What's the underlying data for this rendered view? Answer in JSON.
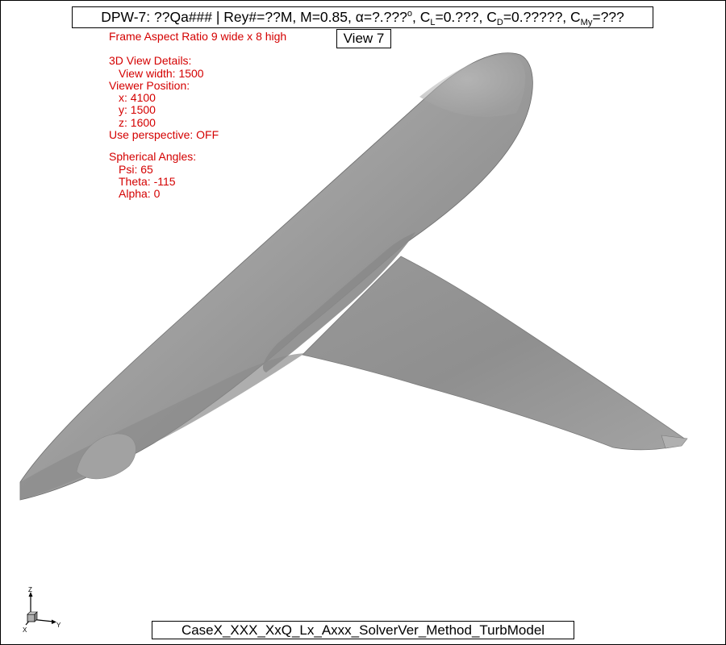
{
  "title": {
    "prefix": "DPW-7: ??Qa### | Rey#=??M, M=0.85, ",
    "alpha_symbol": "α",
    "alpha_value": "=?.???",
    "degree": "o",
    "cl_label": "C",
    "cl_sub": "L",
    "cl_value": "=0.???, ",
    "cd_label": "C",
    "cd_sub": "D",
    "cd_value": "=0.?????, ",
    "cmy_label": "C",
    "cmy_sub": "My",
    "cmy_value": "=???"
  },
  "view_label": "View 7",
  "notes": {
    "aspect": "Frame Aspect Ratio 9 wide x 8 high",
    "details_header": "3D View Details:",
    "view_width": "View width: 1500",
    "viewer_header": "Viewer Position:",
    "x": "x: 4100",
    "y": "y: 1500",
    "z": "z: 1600",
    "perspective": "Use perspective: OFF",
    "angles_header": "Spherical Angles:",
    "psi": "Psi: 65",
    "theta": "Theta: -115",
    "alpha": "Alpha: 0"
  },
  "case_label": "CaseX_XXX_XxQ_Lx_Axxx_SolverVer_Method_TurbModel",
  "triad": {
    "x": "X",
    "y": "Y",
    "z": "Z"
  },
  "colors": {
    "annotation_red": "#d40000",
    "surface_gray": "#9a9a9a"
  }
}
